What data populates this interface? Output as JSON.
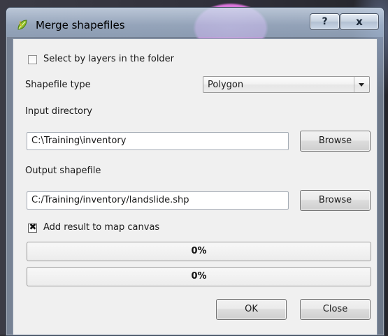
{
  "window": {
    "title": "Merge shapefiles",
    "help_label": "?",
    "close_label": "x"
  },
  "form": {
    "select_by_layers": {
      "label": "Select by layers in the folder",
      "checked": false
    },
    "shapefile_type": {
      "label": "Shapefile type",
      "value": "Polygon"
    },
    "input_directory": {
      "label": "Input directory",
      "value": "C:\\Training\\inventory",
      "browse_label": "Browse"
    },
    "output_shapefile": {
      "label": "Output shapefile",
      "value": "C:/Training/inventory/landslide.shp",
      "browse_label": "Browse"
    },
    "add_result": {
      "label": "Add result to map canvas",
      "checked": true,
      "mark": "✖"
    }
  },
  "progress": [
    {
      "text": "0%",
      "value": 0
    },
    {
      "text": "0%",
      "value": 0
    }
  ],
  "buttons": {
    "ok_label": "OK",
    "close_label": "Close"
  },
  "icons": {
    "app": "qgis-leaf-icon",
    "combo_arrow": "chevron-down-icon"
  }
}
